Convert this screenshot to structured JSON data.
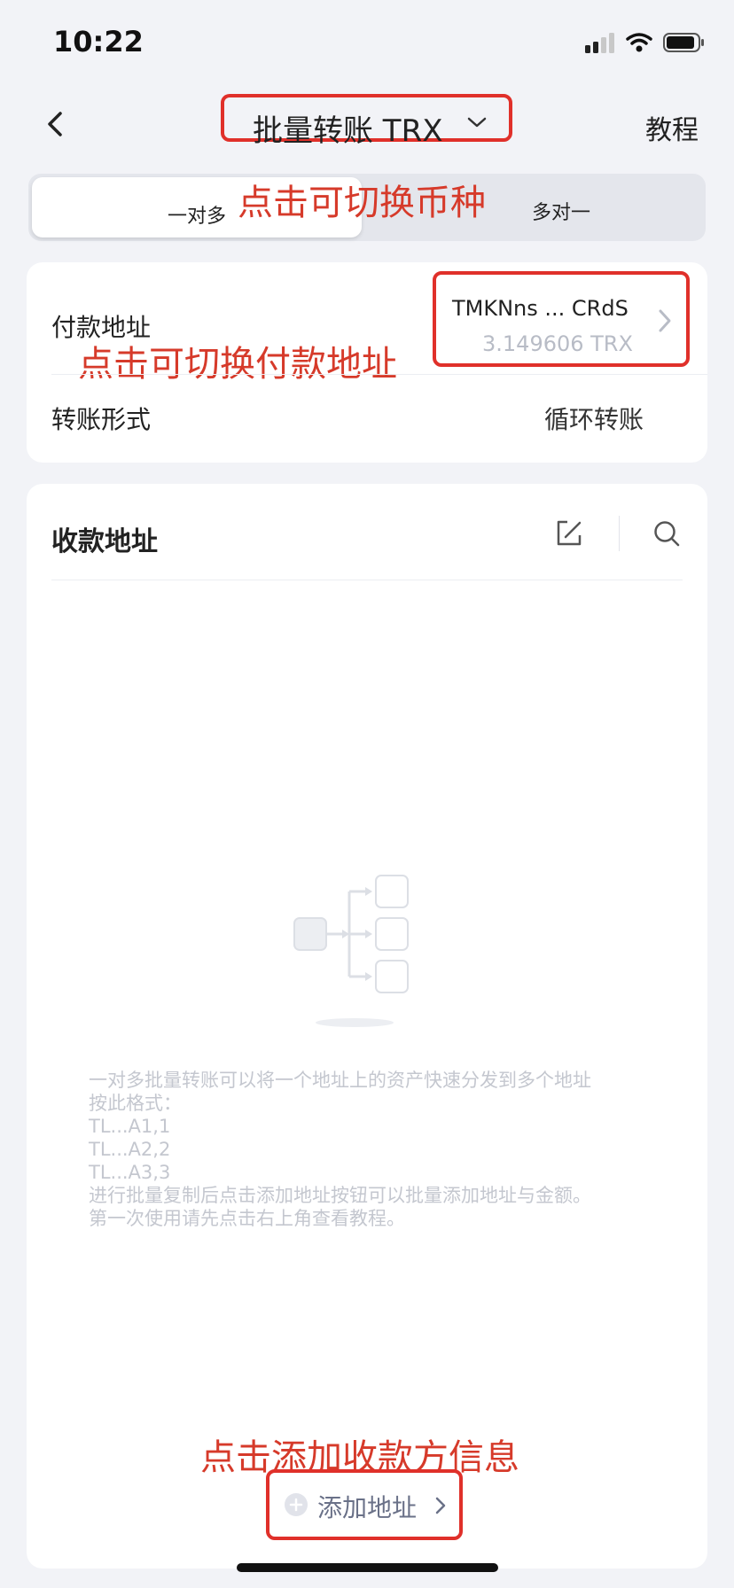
{
  "status_bar": {
    "time": "10:22"
  },
  "nav": {
    "title": "批量转账 TRX",
    "tutorial": "教程"
  },
  "segments": [
    {
      "label": "一对多",
      "active": true
    },
    {
      "label": "多对一",
      "active": false
    }
  ],
  "annotations": {
    "switch_coin": "点击可切换币种",
    "switch_pay": "点击可切换付款地址",
    "add_info": "点击添加收款方信息",
    "color": "#d63a2a"
  },
  "payment": {
    "label": "付款地址",
    "address": "TMKNns ... CRdS",
    "balance": "3.149606 TRX",
    "transfer_form_label": "转账形式",
    "transfer_form_value": "循环转账"
  },
  "receive": {
    "title": "收款地址",
    "empty_lines": [
      "一对多批量转账可以将一个地址上的资产快速分发到多个地址",
      "按此格式：",
      "TL...A1,1",
      "TL...A2,2",
      "TL...A3,3",
      "进行批量复制后点击添加地址按钮可以批量添加地址与金额。",
      "第一次使用请先点击右上角查看教程。"
    ],
    "add_button": "添加地址"
  },
  "icons": {
    "back": "chevron-left-icon",
    "title_dropdown": "chevron-down-icon",
    "edit": "edit-icon",
    "search": "search-icon",
    "add": "plus-circle-icon"
  }
}
